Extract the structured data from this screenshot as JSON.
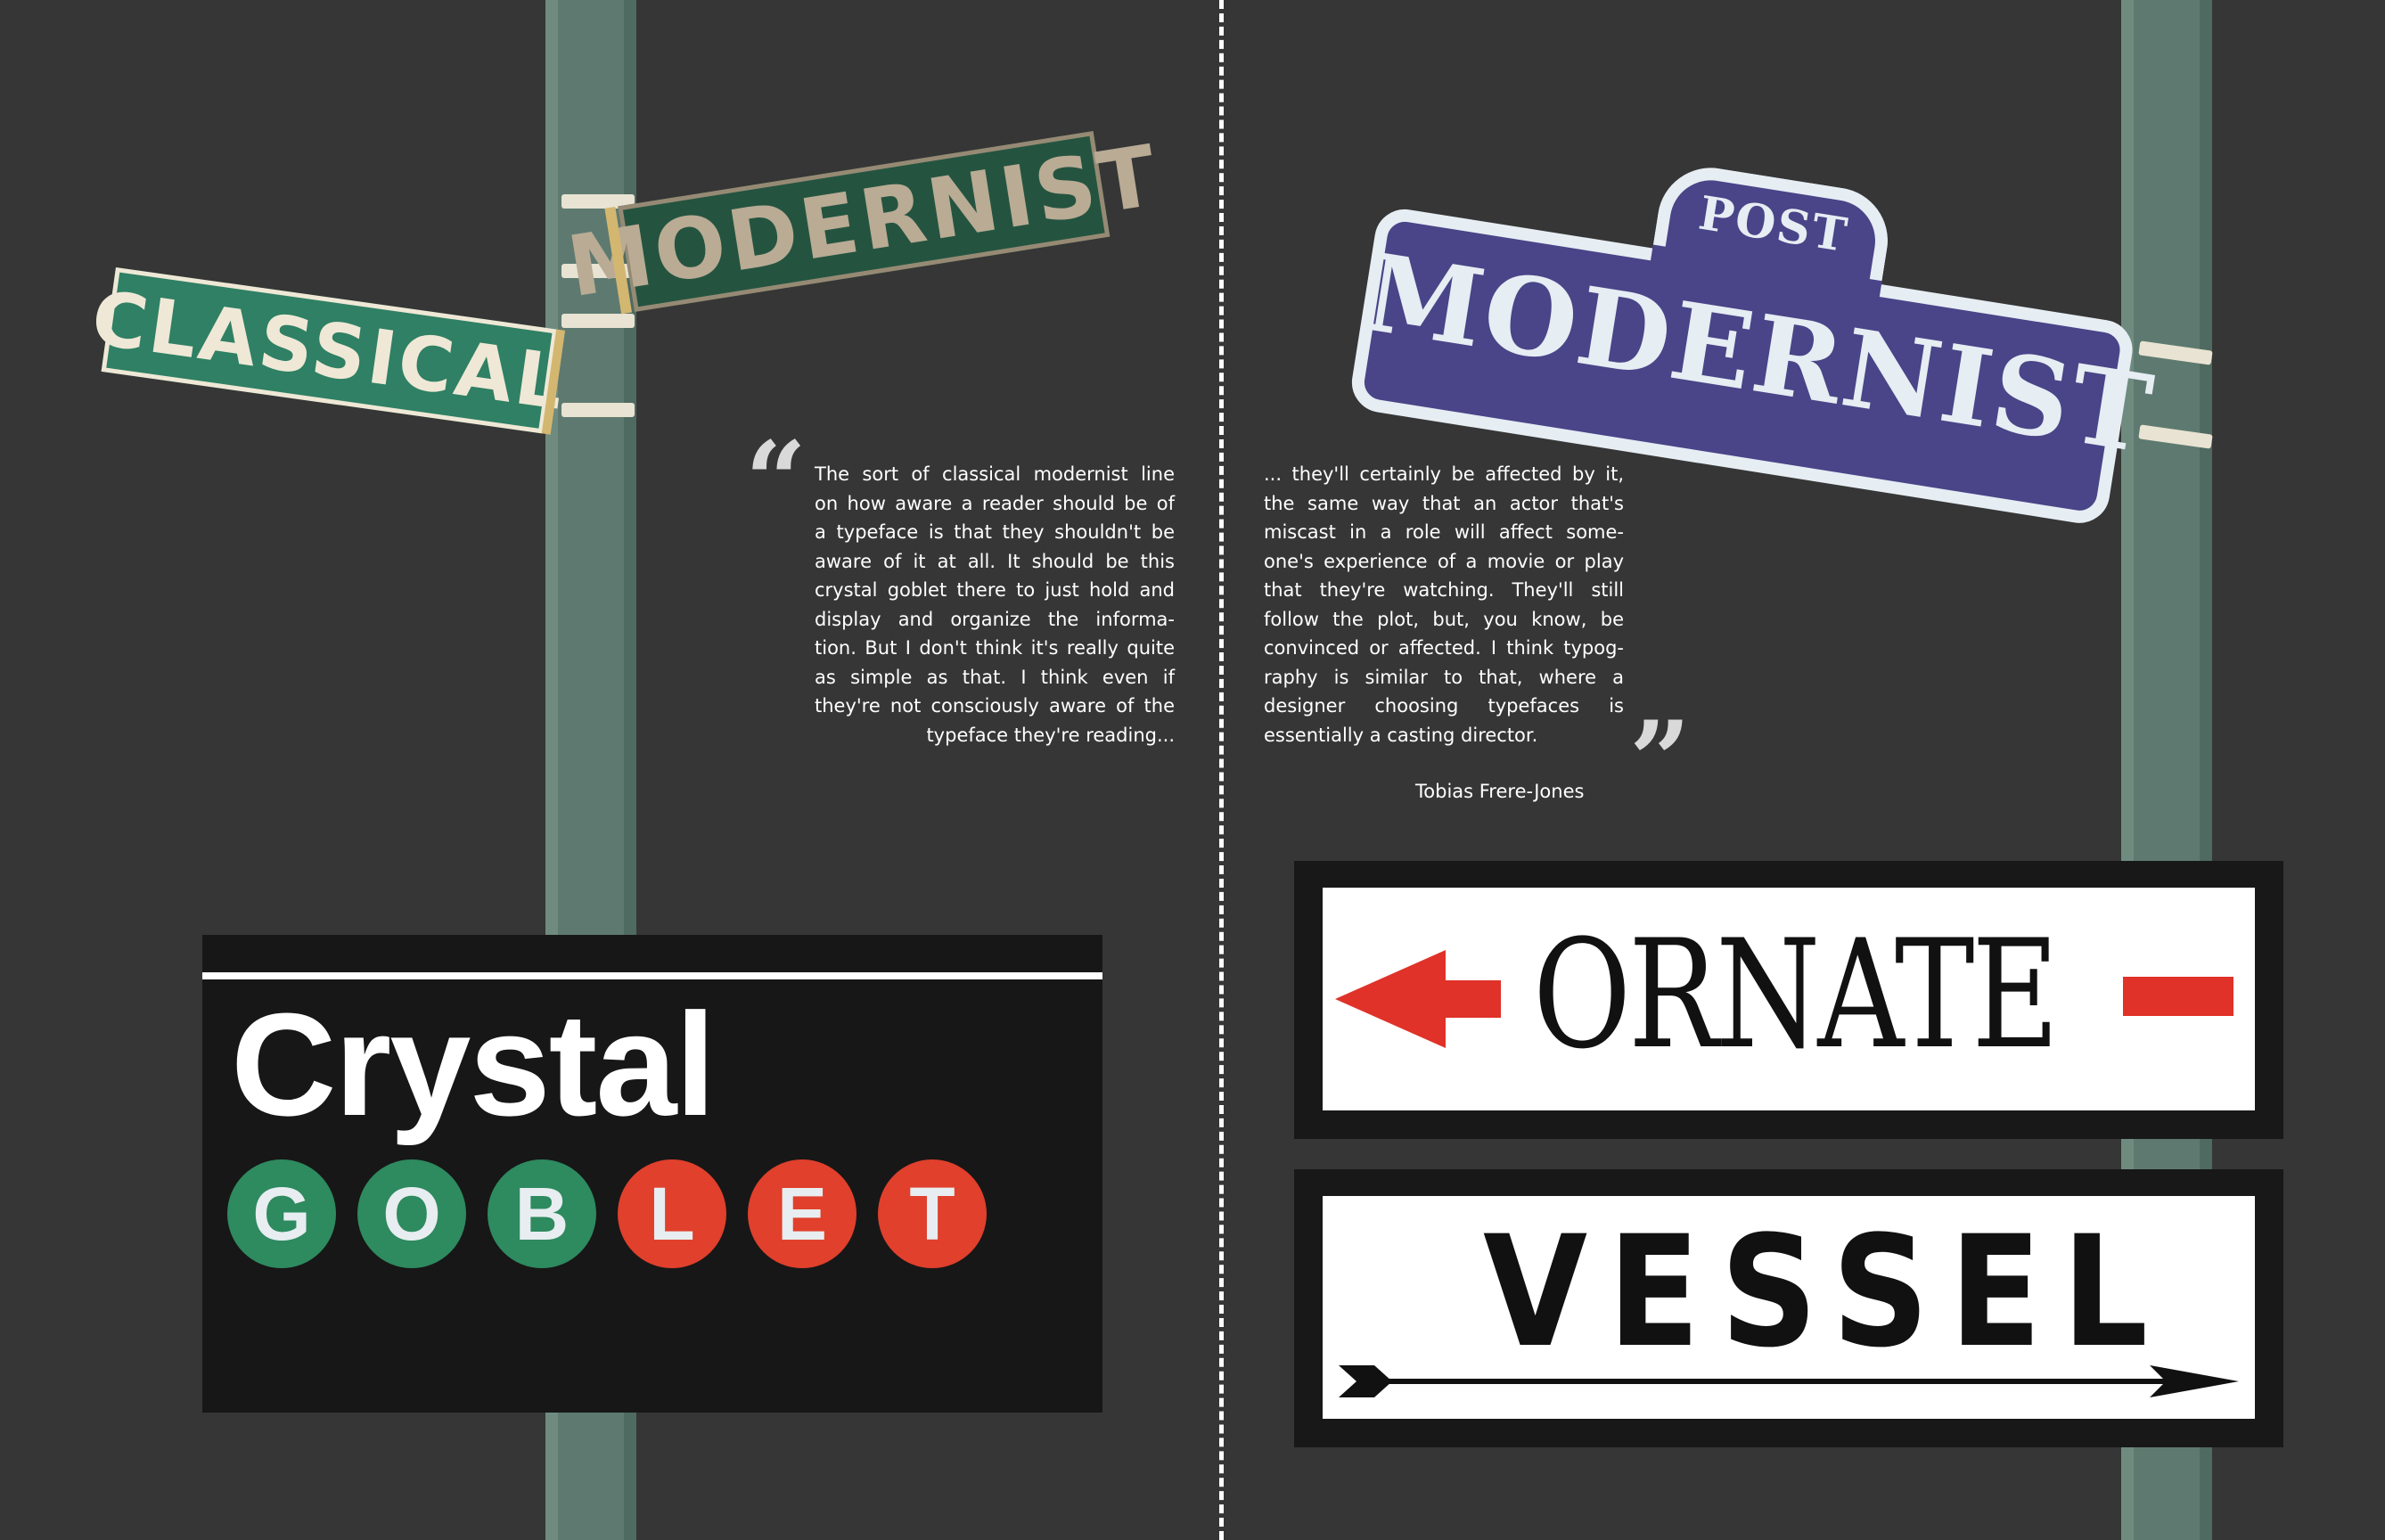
{
  "signs": {
    "classical": "CLASSICAL",
    "modernist": "MODERNIST",
    "post_small": "POST",
    "post_big": "MODERNIST",
    "crystal": "Crystal",
    "goblet_letters": [
      "G",
      "O",
      "B",
      "L",
      "E",
      "T"
    ],
    "ornate": "ORNATE",
    "vessel": "VESSEL"
  },
  "quote": {
    "open_mark": "“",
    "close_mark": "”",
    "left_lines": [
      "The sort of classical modernist line",
      "on how aware a reader should be of",
      "a typeface is that they shouldn't be",
      "aware of it at all. It should be this",
      "crystal goblet there to just hold and",
      "display and organize the informa-",
      "tion. But I don't think it's really quite",
      "as simple as that. I think even if",
      "they're not consciously aware of the",
      "typeface they're reading..."
    ],
    "right_lines": [
      "... they'll certainly be affected by it,",
      "the same way that an actor that's",
      "miscast in a role will affect some-",
      "one's experience of a movie or play",
      "that they're watching. They'll still",
      "follow the plot, but, you know, be",
      "convinced or affected. I think typog-",
      "raphy is similar to that, where a",
      "designer choosing typefaces is",
      "essentially a casting director."
    ],
    "attribution": "Tobias Frere-Jones"
  },
  "colors": {
    "background": "#363636",
    "pole": "#5e7a70",
    "classical_green": "#2f8064",
    "modernist_green": "#245440",
    "post_purple": "#4a4488",
    "goblet_green": "#2e8a5f",
    "goblet_red": "#e0402c",
    "arrow_red": "#e03228"
  }
}
